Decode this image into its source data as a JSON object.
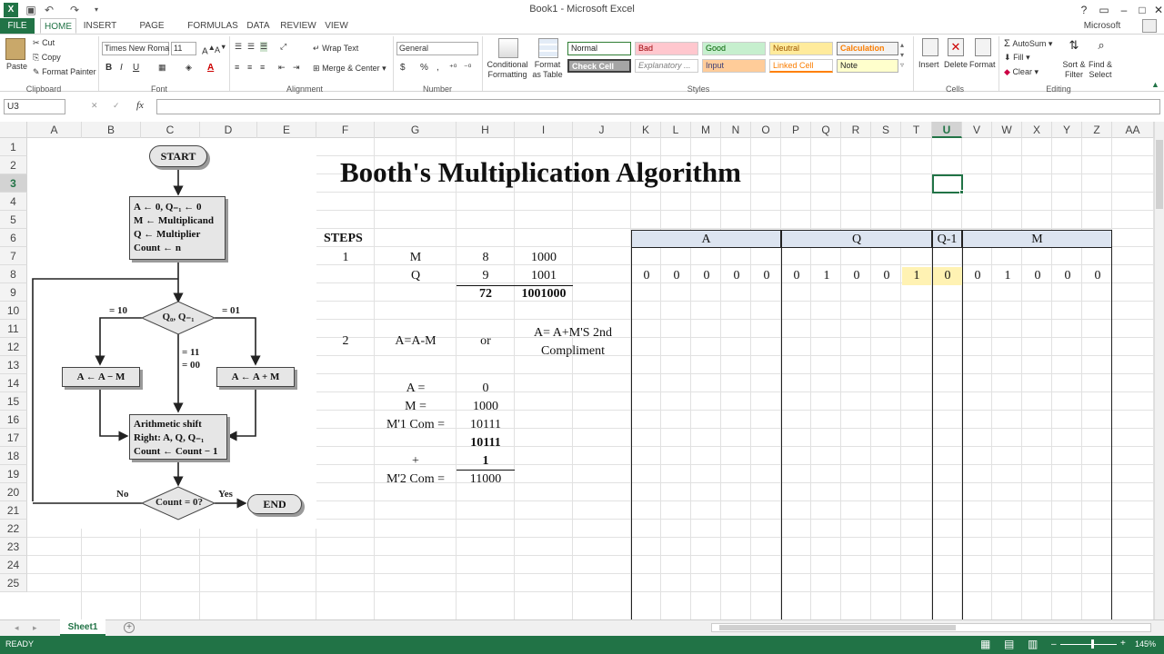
{
  "window": {
    "title": "Book1 - Microsoft Excel",
    "account": "Microsoft account",
    "help": "?"
  },
  "tabs": [
    "FILE",
    "HOME",
    "INSERT",
    "PAGE LAYOUT",
    "FORMULAS",
    "DATA",
    "REVIEW",
    "VIEW"
  ],
  "ribbon": {
    "clipboard": {
      "paste": "Paste",
      "cut": "Cut",
      "copy": "Copy",
      "format_painter": "Format Painter",
      "label": "Clipboard"
    },
    "font": {
      "name": "Times New Roma",
      "size": "11",
      "label": "Font",
      "bold": "B",
      "italic": "I",
      "underline": "U"
    },
    "alignment": {
      "wrap": "Wrap Text",
      "merge": "Merge & Center",
      "label": "Alignment"
    },
    "number": {
      "format": "General",
      "currency": "$",
      "percent": "%",
      "comma": ",",
      "label": "Number"
    },
    "styles": {
      "cond": "Conditional Formatting",
      "table": "Format as Table",
      "normal": "Normal",
      "bad": "Bad",
      "good": "Good",
      "neutral": "Neutral",
      "calculation": "Calculation",
      "check": "Check Cell",
      "explanatory": "Explanatory ...",
      "input": "Input",
      "linked": "Linked Cell",
      "note": "Note",
      "label": "Styles"
    },
    "cells": {
      "insert": "Insert",
      "delete": "Delete",
      "format": "Format",
      "label": "Cells"
    },
    "editing": {
      "autosum": "AutoSum",
      "fill": "Fill",
      "clear": "Clear",
      "sort": "Sort & Filter",
      "find": "Find & Select",
      "label": "Editing"
    }
  },
  "formula_bar": {
    "name_box": "U3",
    "fx": "fx",
    "value": ""
  },
  "columns": [
    "A",
    "B",
    "C",
    "D",
    "E",
    "F",
    "G",
    "H",
    "I",
    "J",
    "K",
    "L",
    "M",
    "N",
    "O",
    "P",
    "Q",
    "R",
    "S",
    "T",
    "U",
    "V",
    "W",
    "X",
    "Y",
    "Z",
    "AA"
  ],
  "rows": [
    "1",
    "2",
    "3",
    "4",
    "5",
    "6",
    "7",
    "8",
    "9",
    "10",
    "11",
    "12",
    "13",
    "14",
    "15",
    "16",
    "17",
    "18",
    "19",
    "20",
    "21",
    "22",
    "23",
    "24",
    "25"
  ],
  "flowchart": {
    "start": "START",
    "init": [
      "A ← 0, Q₋₁ ← 0",
      "M ← Multiplicand",
      "Q ← Multiplier",
      "Count ← n"
    ],
    "decision": "Q₀, Q₋₁",
    "b10": "= 10",
    "b01": "= 01",
    "b11": "= 11",
    "b00": "= 00",
    "sub": "A ← A − M",
    "add": "A ← A + M",
    "shift": [
      "Arithmetic shift",
      "Right: A, Q, Q₋₁",
      "Count ← Count − 1"
    ],
    "count": "Count = 0?",
    "no": "No",
    "yes": "Yes",
    "end": "END"
  },
  "sheet": {
    "title": "Booth's Multiplication Algorithm",
    "steps": "STEPS",
    "r7": {
      "f": "1",
      "g": "M",
      "h": "8",
      "i": "1000"
    },
    "r8": {
      "g": "Q",
      "h": "9",
      "i": "1001"
    },
    "r9": {
      "h": "72",
      "i": "1001000"
    },
    "r11": {
      "f": "2",
      "g": "A=A-M",
      "h": "or",
      "i": "A= A+M'S 2nd Compliment"
    },
    "r13": {
      "g": "A =",
      "h": "0"
    },
    "r14": {
      "g": "M =",
      "h": "1000"
    },
    "r15": {
      "g": "M'1 Com =",
      "h": "10111"
    },
    "r16": {
      "h": "10111"
    },
    "r17": {
      "g": "+",
      "h": "1"
    },
    "r18": {
      "g": "M'2 Com =",
      "h": "11000"
    },
    "table_headers": [
      "A",
      "Q",
      "Q-1",
      "M"
    ],
    "bits": [
      "0",
      "0",
      "0",
      "0",
      "0",
      "0",
      "1",
      "0",
      "0",
      "1",
      "0",
      "0",
      "1",
      "0",
      "0",
      "0"
    ],
    "highlight_color": "#fff2b3",
    "header_color": "#dce4f0"
  },
  "sheet_tab": "Sheet1",
  "status": {
    "ready": "READY",
    "zoom": "145%"
  }
}
